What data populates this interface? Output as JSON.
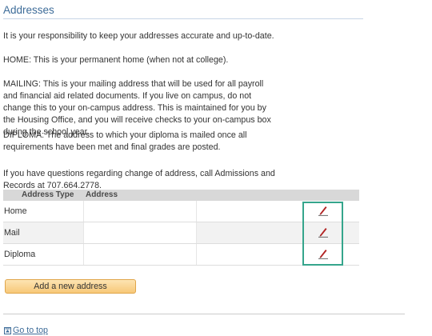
{
  "page": {
    "title": "Addresses"
  },
  "info": {
    "p1": "It is your responsibility to keep your addresses accurate and up-to-date.",
    "p2": "HOME: This is your permanent home (when not at college).",
    "p3": "MAILING: This is your mailing address that will be used for all payroll and financial aid related documents. If you live on campus, do not change this to your on-campus address. This is maintained for you by the Housing Office, and you will receive checks to your on-campus box during the school year.",
    "p4": "DIPLOMA: The address to which your diploma is mailed once all requirements have been met and final grades are posted.",
    "p5": "If you have questions regarding change of address, call Admissions and Records at 707.664.2778."
  },
  "table": {
    "headers": {
      "type": "Address Type",
      "address": "Address"
    },
    "rows": [
      {
        "type": "Home",
        "address": "",
        "edit_icon": "edit-pencil-icon"
      },
      {
        "type": "Mail",
        "address": "",
        "edit_icon": "edit-pencil-icon"
      },
      {
        "type": "Diploma",
        "address": "",
        "edit_icon": "edit-pencil-icon"
      }
    ]
  },
  "actions": {
    "add_address_label": "Add a new address",
    "go_to_top_label": "Go to top"
  },
  "colors": {
    "title": "#3d6c99",
    "header_bg": "#d8d8d8",
    "button_bg": "#f9d48f",
    "button_border": "#e0a64b",
    "highlight": "#35a58c",
    "edit_icon": "#b22222"
  }
}
